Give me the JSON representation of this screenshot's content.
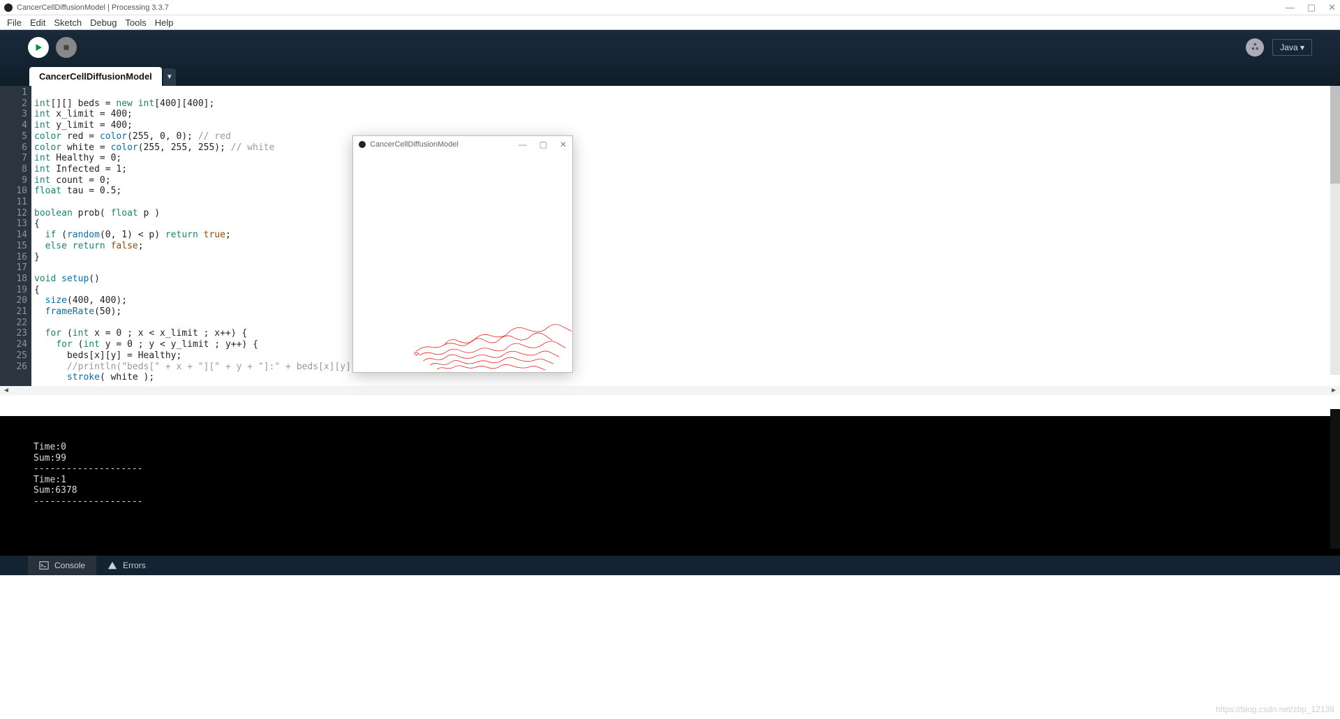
{
  "window": {
    "title": "CancerCellDiffusionModel | Processing 3.3.7",
    "minimize": "—",
    "maximize": "▢",
    "close": "✕"
  },
  "menu": {
    "file": "File",
    "edit": "Edit",
    "sketch": "Sketch",
    "debug": "Debug",
    "tools": "Tools",
    "help": "Help"
  },
  "toolbar": {
    "mode_label": "Java ▾",
    "bee": "ஃ"
  },
  "tabs": {
    "active": "CancerCellDiffusionModel",
    "arrow": "▼"
  },
  "code": {
    "lines": [
      "1",
      "2",
      "3",
      "4",
      "5",
      "6",
      "7",
      "8",
      "9",
      "10",
      "11",
      "12",
      "13",
      "14",
      "15",
      "16",
      "17",
      "18",
      "19",
      "20",
      "21",
      "22",
      "23",
      "24",
      "25",
      "26"
    ],
    "l1a": "int",
    "l1b": "[][] beds = ",
    "l1c": "new",
    "l1d": " ",
    "l1e": "int",
    "l1f": "[400][400];",
    "l2a": "int",
    "l2b": " x_limit = 400;",
    "l3a": "int",
    "l3b": " y_limit = 400;",
    "l4a": "color",
    "l4b": " red = ",
    "l4c": "color",
    "l4d": "(255, 0, 0); ",
    "l4e": "// red",
    "l5a": "color",
    "l5b": " white = ",
    "l5c": "color",
    "l5d": "(255, 255, 255); ",
    "l5e": "// white",
    "l6a": "int",
    "l6b": " Healthy = 0;",
    "l7a": "int",
    "l7b": " Infected = 1;",
    "l8a": "int",
    "l8b": " count = 0;",
    "l9a": "float",
    "l9b": " tau = 0.5;",
    "l10": "",
    "l11a": "boolean",
    "l11b": " prob( ",
    "l11c": "float",
    "l11d": " p )",
    "l12": "{",
    "l13a": "  ",
    "l13b": "if",
    "l13c": " (",
    "l13d": "random",
    "l13e": "(0, 1) < p) ",
    "l13f": "return",
    "l13g": " ",
    "l13h": "true",
    "l13i": ";",
    "l14a": "  ",
    "l14b": "else",
    "l14c": " ",
    "l14d": "return",
    "l14e": " ",
    "l14f": "false",
    "l14g": ";",
    "l15": "}",
    "l16": "",
    "l17a": "void",
    "l17b": " ",
    "l17c": "setup",
    "l17d": "()",
    "l18": "{",
    "l19a": "  ",
    "l19b": "size",
    "l19c": "(400, 400);",
    "l20a": "  ",
    "l20b": "frameRate",
    "l20c": "(50);",
    "l21": "",
    "l22a": "  ",
    "l22b": "for",
    "l22c": " (",
    "l22d": "int",
    "l22e": " x = 0 ; x < x_limit ; x++) {",
    "l23a": "    ",
    "l23b": "for",
    "l23c": " (",
    "l23d": "int",
    "l23e": " y = 0 ; y < y_limit ; y++) {",
    "l24": "      beds[x][y] = Healthy;",
    "l25a": "      ",
    "l25b": "//println(\"beds[\" + x + \"][\" + y + \"]:\" + beds[x][y]);",
    "l26a": "      ",
    "l26b": "stroke",
    "l26c": "( white );"
  },
  "console": {
    "out": "\n\nTime:0\nSum:99\n--------------------\nTime:1\nSum:6378\n--------------------"
  },
  "status": {
    "console": "Console",
    "errors": "Errors"
  },
  "footer": {
    "url": "https://blog.csdn.net/zbp_12138"
  },
  "sketch": {
    "title": "CancerCellDiffusionModel",
    "minimize": "—",
    "maximize": "▢",
    "close": "✕"
  },
  "hscroll": {
    "left": "◄",
    "right": "►"
  }
}
